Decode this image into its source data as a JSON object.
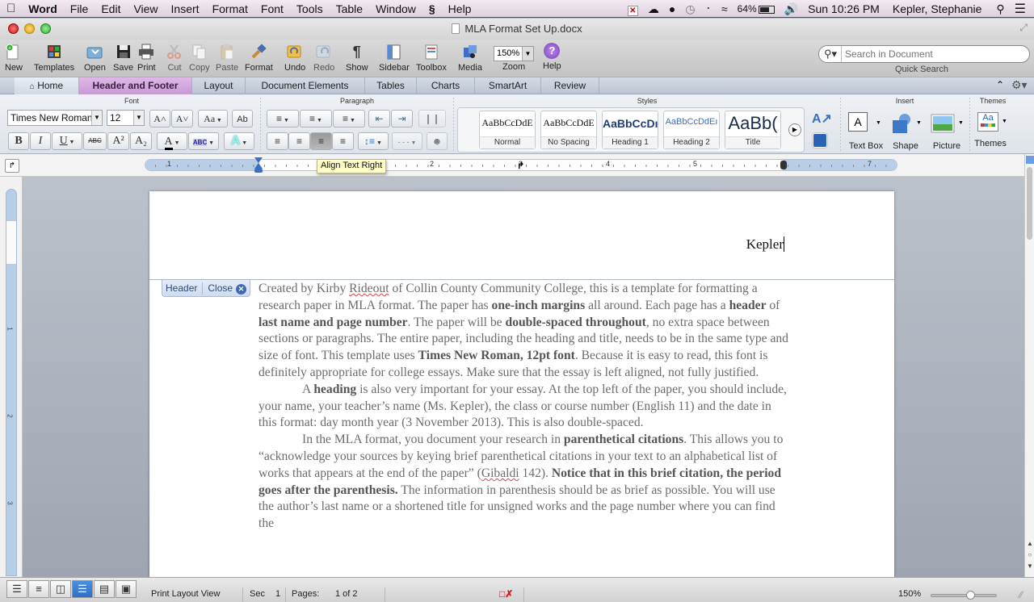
{
  "menubar": {
    "apple_icon": "apple-logo",
    "app_name": "Word",
    "items": [
      "File",
      "Edit",
      "View",
      "Insert",
      "Format",
      "Font",
      "Tools",
      "Table",
      "Window",
      "Script",
      "Help"
    ],
    "battery": "64%",
    "clock": "Sun 10:26 PM",
    "user": "Kepler, Stephanie"
  },
  "window": {
    "title": "MLA Format Set Up.docx"
  },
  "toolbar": {
    "buttons": [
      {
        "label": "New",
        "icon": "new-document-icon"
      },
      {
        "label": "Templates",
        "icon": "templates-icon"
      },
      {
        "label": "Open",
        "icon": "open-folder-icon"
      },
      {
        "label": "Save",
        "icon": "save-disk-icon"
      },
      {
        "label": "Print",
        "icon": "printer-icon"
      },
      {
        "label": "Cut",
        "icon": "scissors-icon"
      },
      {
        "label": "Copy",
        "icon": "copy-icon"
      },
      {
        "label": "Paste",
        "icon": "paste-icon"
      },
      {
        "label": "Format",
        "icon": "format-brush-icon"
      },
      {
        "label": "Undo",
        "icon": "undo-icon"
      },
      {
        "label": "Redo",
        "icon": "redo-icon"
      },
      {
        "label": "Show",
        "icon": "pilcrow-icon"
      },
      {
        "label": "Sidebar",
        "icon": "sidebar-icon"
      },
      {
        "label": "Toolbox",
        "icon": "toolbox-icon"
      },
      {
        "label": "Media",
        "icon": "media-icon"
      }
    ],
    "zoom_value": "150%",
    "zoom_label": "Zoom",
    "help_label": "Help",
    "search_placeholder": "Search in Document",
    "quick_search_label": "Quick Search"
  },
  "ribbon_tabs": [
    {
      "label": "Home",
      "state": "home"
    },
    {
      "label": "Header and Footer",
      "state": "active"
    },
    {
      "label": "Layout"
    },
    {
      "label": "Document Elements"
    },
    {
      "label": "Tables"
    },
    {
      "label": "Charts"
    },
    {
      "label": "SmartArt"
    },
    {
      "label": "Review"
    }
  ],
  "ribbon": {
    "font_group_title": "Font",
    "font_name": "Times New Roman",
    "font_size": "12",
    "paragraph_group_title": "Paragraph",
    "styles_group_title": "Styles",
    "styles": [
      {
        "preview": "AaBbCcDdE",
        "name": "Normal"
      },
      {
        "preview": "AaBbCcDdE",
        "name": "No Spacing"
      },
      {
        "preview": "AaBbCcDı",
        "name": "Heading 1"
      },
      {
        "preview": "AaBbCcDdEı",
        "name": "Heading 2"
      },
      {
        "preview": "AaBb(",
        "name": "Title"
      }
    ],
    "insert_group_title": "Insert",
    "insert_items": [
      "Text Box",
      "Shape",
      "Picture"
    ],
    "themes_group_title": "Themes",
    "themes_label": "Themes",
    "format_buttons": {
      "bold": "B",
      "italic": "I",
      "underline": "U",
      "strike": "ABC",
      "superscript": "A²",
      "subscript": "A₂",
      "grow": "A˄",
      "shrink": "A˅",
      "case": "Aa"
    }
  },
  "ruler": {
    "numbers": [
      "1",
      "2",
      "3",
      "4",
      "5",
      "6",
      "7"
    ],
    "tooltip": "Align Text Right"
  },
  "document": {
    "header_text": "Kepler",
    "header_tag_label": "Header",
    "header_close_label": "Close",
    "paragraphs": [
      {
        "indent": false,
        "runs": [
          {
            "t": "Created by Kirby "
          },
          {
            "t": "Rideout",
            "sq": true
          },
          {
            "t": " of Collin County Community College, this is a template for formatting a research paper in MLA format. The paper has "
          },
          {
            "t": "one-inch margins",
            "b": true
          },
          {
            "t": " all around. Each page has a "
          },
          {
            "t": "header",
            "b": true
          },
          {
            "t": " of "
          },
          {
            "t": "last name and page number",
            "b": true
          },
          {
            "t": ". The paper will be "
          },
          {
            "t": "double-spaced throughout",
            "b": true
          },
          {
            "t": ", no extra space between sections or paragraphs. The entire paper, including the heading and title, needs to be in the same type and size of font. This template uses "
          },
          {
            "t": "Times New Roman, 12pt font",
            "b": true
          },
          {
            "t": ". Because it is easy to read, this font is definitely appropriate for college essays. Make sure that the essay is left aligned, not fully justified."
          }
        ]
      },
      {
        "indent": true,
        "runs": [
          {
            "t": "A "
          },
          {
            "t": "heading",
            "b": true
          },
          {
            "t": " is also very important for your essay. At the top left of the paper, you should include, your name, your teacher’s name (Ms. Kepler), the class or course number (English 11) and the date in this format: day month year (3 November 2013). This is also double-spaced."
          }
        ]
      },
      {
        "indent": true,
        "runs": [
          {
            "t": "In the MLA format, you document your research in "
          },
          {
            "t": "parenthetical citations",
            "b": true
          },
          {
            "t": ". This allows you to “acknowledge your sources by keying brief parenthetical citations in your text to an alphabetical list of works that appears at the end of the paper” ("
          },
          {
            "t": "Gibaldi",
            "sq": true
          },
          {
            "t": " 142). "
          },
          {
            "t": "Notice that in this brief citation, the period goes after the parenthesis.",
            "b": true
          },
          {
            "t": " The information in parenthesis should be as brief as possible. You will use the author’s last name or a shortened title for unsigned works and the page number where you can find the"
          }
        ]
      }
    ]
  },
  "statusbar": {
    "view_label": "Print Layout View",
    "sec_label": "Sec",
    "sec_value": "1",
    "pages_label": "Pages:",
    "pages_value": "1 of 2",
    "zoom_value": "150%",
    "zoom_slider_fraction": 0.62
  },
  "colors": {
    "active_tab": "#c89ad4",
    "accent_blue": "#3e6bb0",
    "help_purple": "#8a4fc9"
  }
}
